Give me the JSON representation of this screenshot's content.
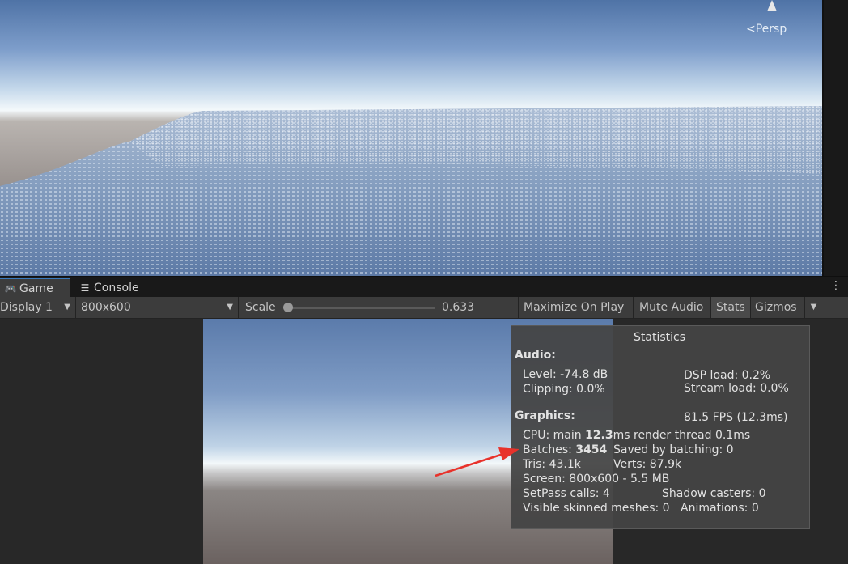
{
  "scene": {
    "persp_label": "Persp"
  },
  "tabs": [
    {
      "label": "Game",
      "icon": "gamepad-icon"
    },
    {
      "label": "Console",
      "icon": "console-icon"
    }
  ],
  "toolbar": {
    "display": "Display 1",
    "resolution": "800x600",
    "scale_label": "Scale",
    "scale_value": "0.633",
    "scale_fraction": 0.0,
    "maximize": "Maximize On Play",
    "mute": "Mute Audio",
    "stats": "Stats",
    "gizmos": "Gizmos"
  },
  "stats": {
    "title": "Statistics",
    "audio_header": "Audio:",
    "level": "Level: -74.8 dB",
    "clipping": "Clipping: 0.0%",
    "dsp_load": "DSP load: 0.2%",
    "stream_load": "Stream load: 0.0%",
    "graphics_header": "Graphics:",
    "fps": "81.5 FPS (12.3ms)",
    "cpu_prefix": "CPU: main ",
    "cpu_main": "12.3",
    "cpu_suffix": "ms  render thread 0.1ms",
    "batches_prefix": "Batches: ",
    "batches": "3454",
    "saved_by_batching": "Saved by batching: 0",
    "tris": "Tris: 43.1k",
    "verts": "Verts: 87.9k",
    "screen": "Screen: 800x600 - 5.5 MB",
    "setpass": "SetPass calls: 4",
    "shadow_casters": "Shadow casters: 0",
    "skinned": "Visible skinned meshes: 0",
    "animations": "Animations: 0"
  },
  "colors": {
    "accent": "#3a79bb",
    "annotation_arrow": "#e8322b"
  }
}
